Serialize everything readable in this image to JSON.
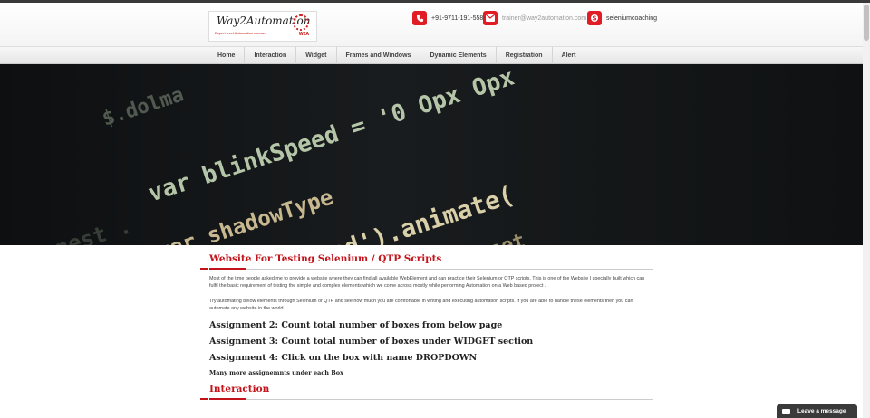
{
  "header": {
    "logo_title": "Way2Automation",
    "logo_tagline": "Expert level Automation courses",
    "logo_mark_text": "W2A",
    "phone": "+91-9711-191-558",
    "email": "trainer@way2automation.com",
    "skype": "seleniumcoaching"
  },
  "nav": {
    "items": [
      "Home",
      "Interaction",
      "Widget",
      "Frames and Windows",
      "Dynamic Elements",
      "Registration",
      "Alert"
    ]
  },
  "hero": {
    "code_lines": [
      "$.dolma",
      "var blinkSpeed = '0 Opx Opx",
      "var shadowType",
      "$('afform_send').animate(",
      "setTimeout('scrollToReset",
      "$ nest ."
    ]
  },
  "content": {
    "heading": "Website For Testing Selenium / QTP Scripts",
    "para1": "Most of the time people asked me to provide a website where they can find all available WebElement and can practice their Selenium or QTP scripts. This is one of the Website I specially built which can fulfil the basic requirement of testing the simple and complex elements which we come across mostly while performing Automation on a Web based project .",
    "para2": "Try automating below elements through Selenium or QTP and see how much you are comfortable in writing and executing automation scripts. If you are able to handle these elements then you can automate any website in the world.",
    "assignments": [
      "Assignment 2: Count total number of boxes from below page",
      "Assignment 3: Count total number of boxes under WIDGET section",
      "Assignment 4: Click on the box with name DROPDOWN"
    ],
    "more": "Many more assignemnts under each Box",
    "section_heading": "Interaction"
  },
  "chat": {
    "label": "Leave a message"
  },
  "colors": {
    "brand_red": "#e01c24",
    "heading_red": "#c3141c"
  }
}
